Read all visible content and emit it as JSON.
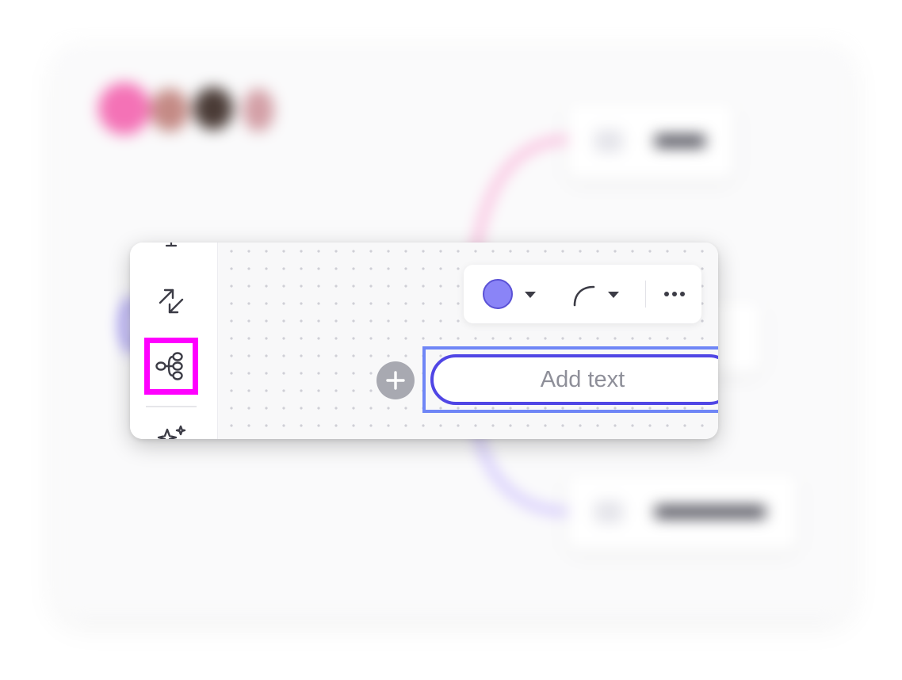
{
  "background_board": {
    "avatar_colors": [
      "#f472b6",
      "#c48a85",
      "#4a3b36",
      "#d39fa6"
    ],
    "branch_colors": {
      "upper": "#f9a8d4",
      "lower": "#c4b5fd",
      "left": "#8b7cf6"
    }
  },
  "sidebar": {
    "tools": [
      {
        "name": "connector-tool",
        "icon": "connector-arrows-icon"
      },
      {
        "name": "mindmap-tool",
        "icon": "mindmap-icon",
        "highlighted": true
      },
      {
        "name": "ai-sparkle-tool",
        "icon": "sparkle-icon"
      }
    ],
    "highlight_color": "#ff00ff"
  },
  "context_menu": {
    "node_color": "#8a84f7",
    "node_color_border": "#5b52d6",
    "icons": [
      "color-picker-icon",
      "curve-style-icon",
      "more-options-icon"
    ]
  },
  "mindmap_node": {
    "placeholder": "Add text",
    "border_color": "#5046e5",
    "selection_color": "#6f86f6",
    "add_button_color": "#a8a9b1"
  }
}
